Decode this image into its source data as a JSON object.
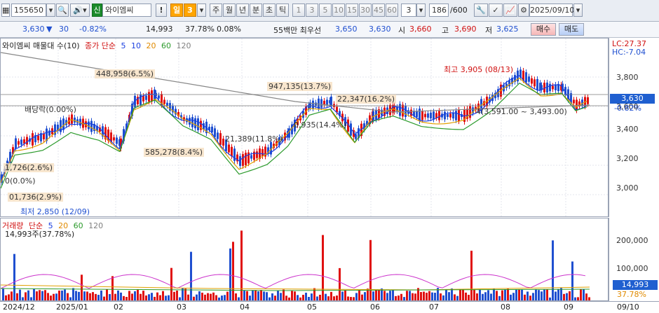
{
  "toolbar": {
    "code": "155650",
    "badge": "신",
    "name": "와이엠씨",
    "excl": "!",
    "period_unit": "일",
    "period_num": "3",
    "period_buttons": [
      "주",
      "월",
      "년",
      "분",
      "초",
      "틱"
    ],
    "interval_buttons": [
      "1",
      "3",
      "5",
      "10",
      "15",
      "30",
      "45",
      "60"
    ],
    "interval_value": "3",
    "count": "186",
    "count_total": "/600",
    "date": "2025/09/10"
  },
  "info": {
    "price": "3,630",
    "change": "30",
    "change_pct": "-0.82%",
    "volume": "14,993",
    "vol_pct": "37.78%",
    "turnover_pct": "0.08%",
    "status": "55백만 최우선",
    "ask": "3,650",
    "bid": "3,630",
    "open_label": "시",
    "open": "3,660",
    "high_label": "고",
    "high": "3,690",
    "low_label": "저",
    "low": "3,625",
    "buy": "매수",
    "sell": "매도"
  },
  "price_panel": {
    "legend_title": "와이엠씨 매물대 수(10)",
    "legend_ma": "종가 단순",
    "ma_periods": [
      "5",
      "10",
      "20",
      "60",
      "120"
    ],
    "ma_colors": [
      "#1a3fe0",
      "#e08a00",
      "#2b9a2b",
      "#808080",
      "#808080"
    ],
    "lc": "LC:27.37",
    "hc": "HC:-7.04",
    "current_price": "3,630",
    "current_pct": "-0.82%",
    "y_ticks": [
      "3,800",
      "3,600",
      "3,400",
      "3,200",
      "3,000"
    ]
  },
  "annotations": {
    "a1": "448,958(6.5%)",
    "a2": "947,135(13.7%)",
    "a3": "22,347(16.2%)",
    "a4": "배당락(0.00%)",
    "a5": "585,278(8.4%)",
    "a6": "21,389(11.8%)",
    "a7": "0,935(14.4%)",
    "a8": "1,726(2.6%)",
    "a9": "0(0.0%)",
    "a10": "01,736(2.9%)",
    "high_mark": "최고 3,905 (08/13)",
    "low_mark": "최저 2,850 (12/09)",
    "range": "4(3,591.00 ~ 3,493.00)"
  },
  "volume_panel": {
    "legend_title": "거래량",
    "legend_ma": "단순",
    "ma_periods": [
      "5",
      "20",
      "60",
      "120"
    ],
    "summary": "14,993주(37.78%)",
    "y_ticks": [
      "200,000",
      "100,000"
    ],
    "current_volume": "14,993",
    "current_pct": "37.78%"
  },
  "x_axis": [
    "2024/12",
    "2025/01",
    "02",
    "03",
    "04",
    "05",
    "06",
    "07",
    "08",
    "09",
    "09/10"
  ]
}
